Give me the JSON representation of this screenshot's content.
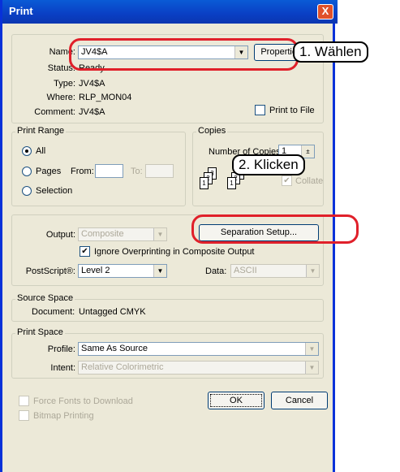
{
  "window": {
    "title": "Print",
    "close_glyph": "X"
  },
  "printer": {
    "name_label": "Name:",
    "name_value": "JV4$A",
    "properties_label": "Properties...",
    "status_label": "Status:",
    "status_value": "Ready",
    "type_label": "Type:",
    "type_value": "JV4$A",
    "where_label": "Where:",
    "where_value": "RLP_MON04",
    "comment_label": "Comment:",
    "comment_value": "JV4$A",
    "print_to_file_label": "Print to File",
    "print_to_file_checked": false
  },
  "print_range": {
    "title": "Print Range",
    "all_label": "All",
    "pages_label": "Pages",
    "from_label": "From:",
    "to_label": "To:",
    "selection_label": "Selection",
    "selected": "all"
  },
  "copies": {
    "title": "Copies",
    "number_label": "Number of Copies:",
    "number_value": "1",
    "collate_label": "Collate",
    "collate_checked": true
  },
  "output": {
    "output_label": "Output:",
    "output_value": "Composite",
    "separation_setup_label": "Separation Setup...",
    "ignore_overprinting_label": "Ignore Overprinting in Composite Output",
    "ignore_overprinting_checked": true,
    "postscript_label": "PostScript®:",
    "postscript_value": "Level 2",
    "data_label": "Data:",
    "data_value": "ASCII"
  },
  "source_space": {
    "title": "Source Space",
    "document_label": "Document:",
    "document_value": "Untagged CMYK"
  },
  "print_space": {
    "title": "Print Space",
    "profile_label": "Profile:",
    "profile_value": "Same As Source",
    "intent_label": "Intent:",
    "intent_value": "Relative Colorimetric"
  },
  "options": {
    "force_fonts_label": "Force Fonts to Download",
    "bitmap_printing_label": "Bitmap Printing"
  },
  "buttons": {
    "ok_label": "OK",
    "cancel_label": "Cancel"
  },
  "annotations": {
    "step1": "1. Wählen",
    "step2": "2. Klicken",
    "highlight_color": "#e0202a"
  }
}
